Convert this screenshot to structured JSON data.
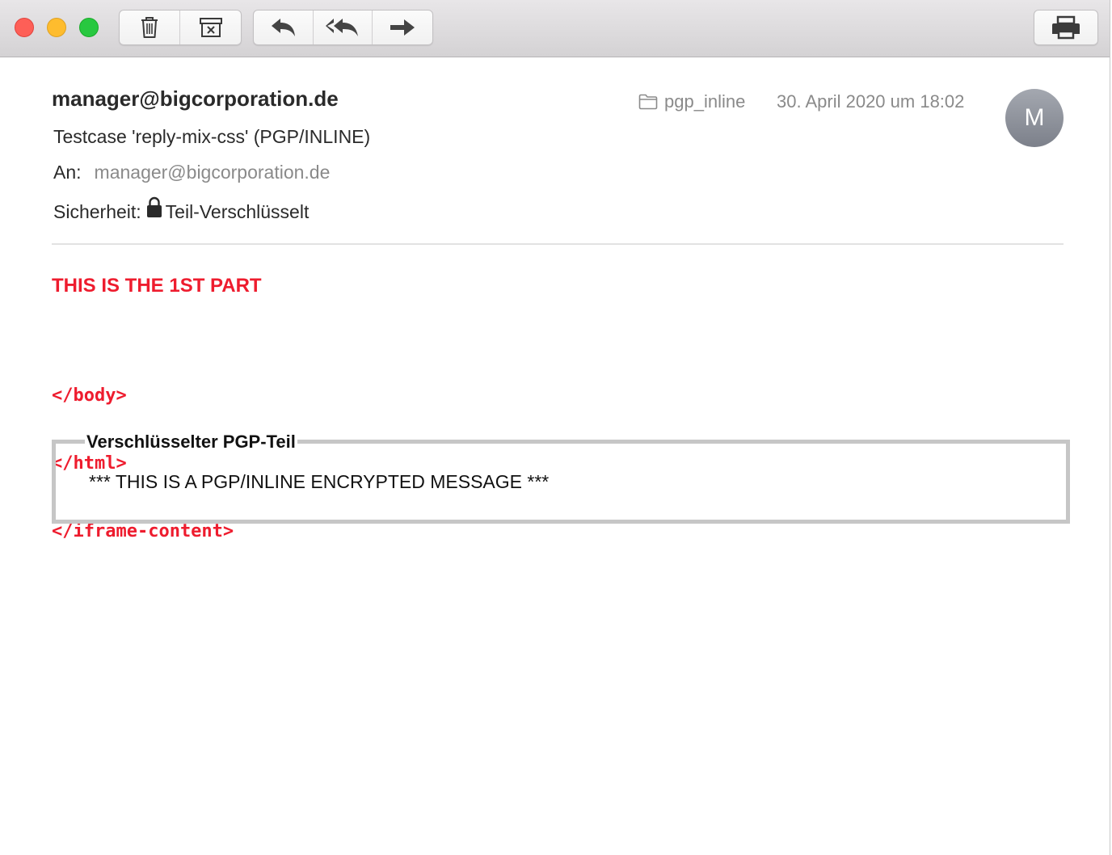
{
  "toolbar": {
    "window_controls": [
      "close",
      "minimize",
      "maximize"
    ],
    "buttons": {
      "delete": {
        "icon": "trash-icon"
      },
      "junk": {
        "icon": "junk-box-icon"
      },
      "reply": {
        "icon": "reply-arrow-icon"
      },
      "reply_all": {
        "icon": "reply-all-arrow-icon"
      },
      "forward": {
        "icon": "forward-arrow-icon"
      },
      "print": {
        "icon": "printer-icon"
      }
    }
  },
  "header": {
    "sender": "manager@bigcorporation.de",
    "subject": "Testcase 'reply-mix-css' (PGP/INLINE)",
    "to_label": "An:",
    "to_value": "manager@bigcorporation.de",
    "security_label": "Sicherheit:",
    "security_value": "Teil-Verschlüsselt",
    "folder": "pgp_inline",
    "date": "30. April 2020 um 18:02",
    "avatar_initial": "M"
  },
  "body": {
    "part1": "THIS IS THE 1ST PART",
    "code_lines": [
      "</body>",
      "</html>",
      "</iframe-content>"
    ],
    "pgp_legend": "Verschlüsselter PGP-Teil",
    "pgp_text": "*** THIS IS A PGP/INLINE ENCRYPTED MESSAGE ***"
  },
  "colors": {
    "accent_red": "#ee1c2e",
    "muted_text": "#8a8a8a",
    "avatar": "#8e929a",
    "pgp_border": "#c6c6c6"
  }
}
